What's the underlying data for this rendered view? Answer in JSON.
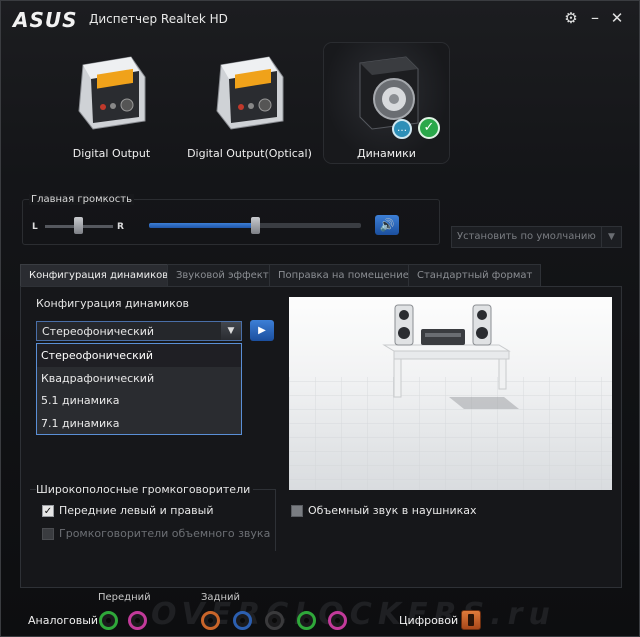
{
  "window": {
    "brand": "ASUS",
    "title": "Диспетчер Realtek HD"
  },
  "titlebar": {
    "settings_icon": "gear-icon",
    "minimize_icon": "minimize-icon",
    "close_icon": "close-icon"
  },
  "devices": [
    {
      "label": "Digital Output",
      "icon": "digital-output-icon",
      "active": false
    },
    {
      "label": "Digital Output(Optical)",
      "icon": "digital-output-optical-icon",
      "active": false
    },
    {
      "label": "Динамики",
      "icon": "speaker-icon",
      "active": true
    }
  ],
  "volume": {
    "title": "Главная громкость",
    "left": "L",
    "right": "R",
    "balance_level": 0.5,
    "master_level": 0.5,
    "mute_icon": "speaker-volume-icon"
  },
  "default_dropdown": {
    "label": "Установить по умолчанию"
  },
  "tabs": [
    {
      "label": "Конфигурация динамиков",
      "active": true
    },
    {
      "label": "Звуковой эффект",
      "active": false
    },
    {
      "label": "Поправка на помещение",
      "active": false
    },
    {
      "label": "Стандартный формат",
      "active": false
    }
  ],
  "config": {
    "title": "Конфигурация динамиков",
    "selected": "Стереофонический",
    "options": [
      "Стереофонический",
      "Квадрафонический",
      "5.1 динамика",
      "7.1 динамика"
    ],
    "play_icon": "play-icon"
  },
  "wideband": {
    "title": "Широкополосные громкоговорители",
    "front": {
      "label": "Передние левый и правый",
      "checked": true
    },
    "surround": {
      "label": "Громкоговорители объемного звука",
      "checked": false,
      "disabled": true
    }
  },
  "headphones": {
    "label": "Объемный звук в наушниках",
    "checked": false
  },
  "jacks": {
    "front_label": "Передний",
    "rear_label": "Задний",
    "analog_label": "Аналоговый",
    "digital_label": "Цифровой",
    "colors": {
      "front": [
        "#2fa83a",
        "#c23a9a"
      ],
      "rear": [
        "#c9652a",
        "#2c5fb0",
        "#2a2a2a",
        "#2fa83a",
        "#c23a9a"
      ]
    }
  }
}
